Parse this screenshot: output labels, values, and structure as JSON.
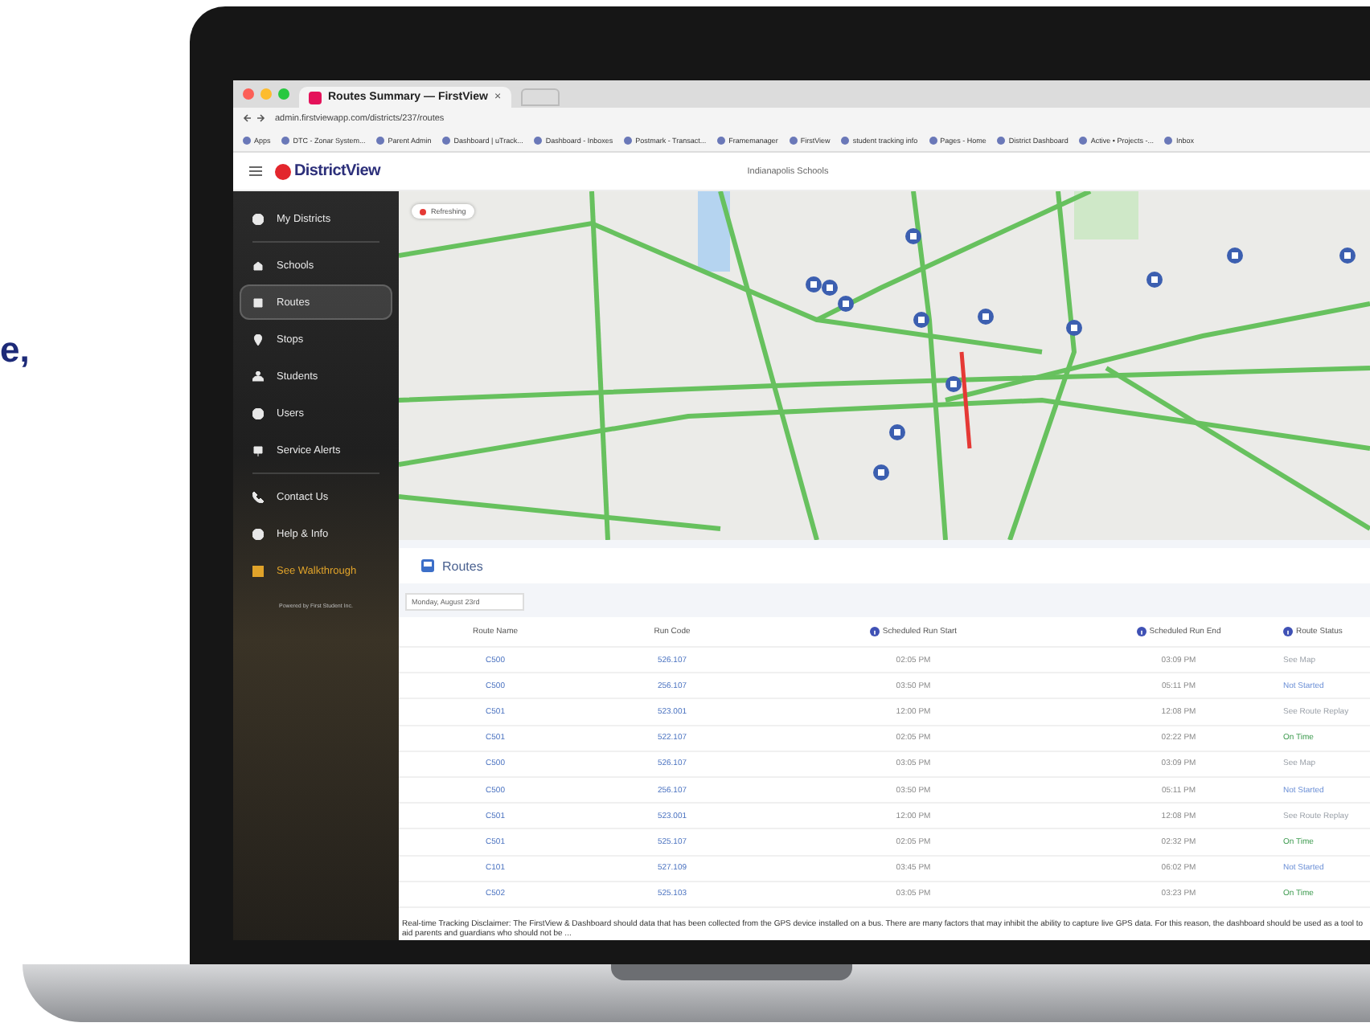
{
  "side_text": "e,",
  "browser": {
    "tab_title": "Routes Summary — FirstView",
    "tab_close": "×",
    "url": "admin.firstviewapp.com/districts/237/routes",
    "bookmarks": [
      "Apps",
      "DTC - Zonar System...",
      "Parent Admin",
      "Dashboard | uTrack...",
      "Dashboard - Inboxes",
      "Postmark - Transact...",
      "Framemanager",
      "FirstView",
      "student tracking info",
      "Pages - Home",
      "District Dashboard",
      "Active • Projects -...",
      "Inbox"
    ]
  },
  "header": {
    "logo_text": "DistrictView",
    "district": "Indianapolis Schools"
  },
  "sidebar": {
    "items": [
      {
        "label": "My Districts",
        "selected": false,
        "kind": "normal"
      },
      {
        "label": "Schools",
        "selected": false,
        "kind": "normal"
      },
      {
        "label": "Routes",
        "selected": true,
        "kind": "normal"
      },
      {
        "label": "Stops",
        "selected": false,
        "kind": "normal"
      },
      {
        "label": "Students",
        "selected": false,
        "kind": "normal"
      },
      {
        "label": "Users",
        "selected": false,
        "kind": "normal"
      },
      {
        "label": "Service Alerts",
        "selected": false,
        "kind": "normal"
      },
      {
        "label": "Contact Us",
        "selected": false,
        "kind": "normal"
      },
      {
        "label": "Help & Info",
        "selected": false,
        "kind": "normal"
      },
      {
        "label": "See Walkthrough",
        "selected": false,
        "kind": "highlight"
      }
    ],
    "footer": "Powered by First Student Inc."
  },
  "map": {
    "status_chip": "Refreshing"
  },
  "routes": {
    "title": "Routes",
    "date": "Monday, August 23rd",
    "columns": [
      {
        "label": "Route Name",
        "info": false
      },
      {
        "label": "Run Code",
        "info": false
      },
      {
        "label": "Scheduled Run Start",
        "info": true
      },
      {
        "label": "Scheduled Run End",
        "info": true
      },
      {
        "label": "Route Status",
        "info": true
      }
    ],
    "rows": [
      {
        "route": "C500",
        "run": "526.107",
        "start": "02:05 PM",
        "end": "03:09 PM",
        "status": "See Map",
        "kind": "link"
      },
      {
        "route": "C500",
        "run": "256.107",
        "start": "03:50 PM",
        "end": "05:11 PM",
        "status": "Not Started",
        "kind": "pending"
      },
      {
        "route": "C501",
        "run": "523.001",
        "start": "12:00 PM",
        "end": "12:08 PM",
        "status": "See Route Replay",
        "kind": "link"
      },
      {
        "route": "C501",
        "run": "522.107",
        "start": "02:05 PM",
        "end": "02:22 PM",
        "status": "On Time",
        "kind": "ok"
      },
      {
        "route": "C500",
        "run": "526.107",
        "start": "03:05 PM",
        "end": "03:09 PM",
        "status": "See Map",
        "kind": "link"
      },
      {
        "route": "C500",
        "run": "256.107",
        "start": "03:50 PM",
        "end": "05:11 PM",
        "status": "Not Started",
        "kind": "pending"
      },
      {
        "route": "C501",
        "run": "523.001",
        "start": "12:00 PM",
        "end": "12:08 PM",
        "status": "See Route Replay",
        "kind": "link"
      },
      {
        "route": "C501",
        "run": "525.107",
        "start": "02:05 PM",
        "end": "02:32 PM",
        "status": "On Time",
        "kind": "ok"
      },
      {
        "route": "C101",
        "run": "527.109",
        "start": "03:45 PM",
        "end": "06:02 PM",
        "status": "Not Started",
        "kind": "pending"
      },
      {
        "route": "C502",
        "run": "525.103",
        "start": "03:05 PM",
        "end": "03:23 PM",
        "status": "On Time",
        "kind": "ok"
      }
    ],
    "disclaimer": "Real-time Tracking Disclaimer: The FirstView & Dashboard should data that has been collected from the GPS device installed on a bus. There are many factors that may inhibit the ability to capture live GPS data. For this reason, the dashboard should be used as a tool to aid parents and guardians who should not be ..."
  }
}
